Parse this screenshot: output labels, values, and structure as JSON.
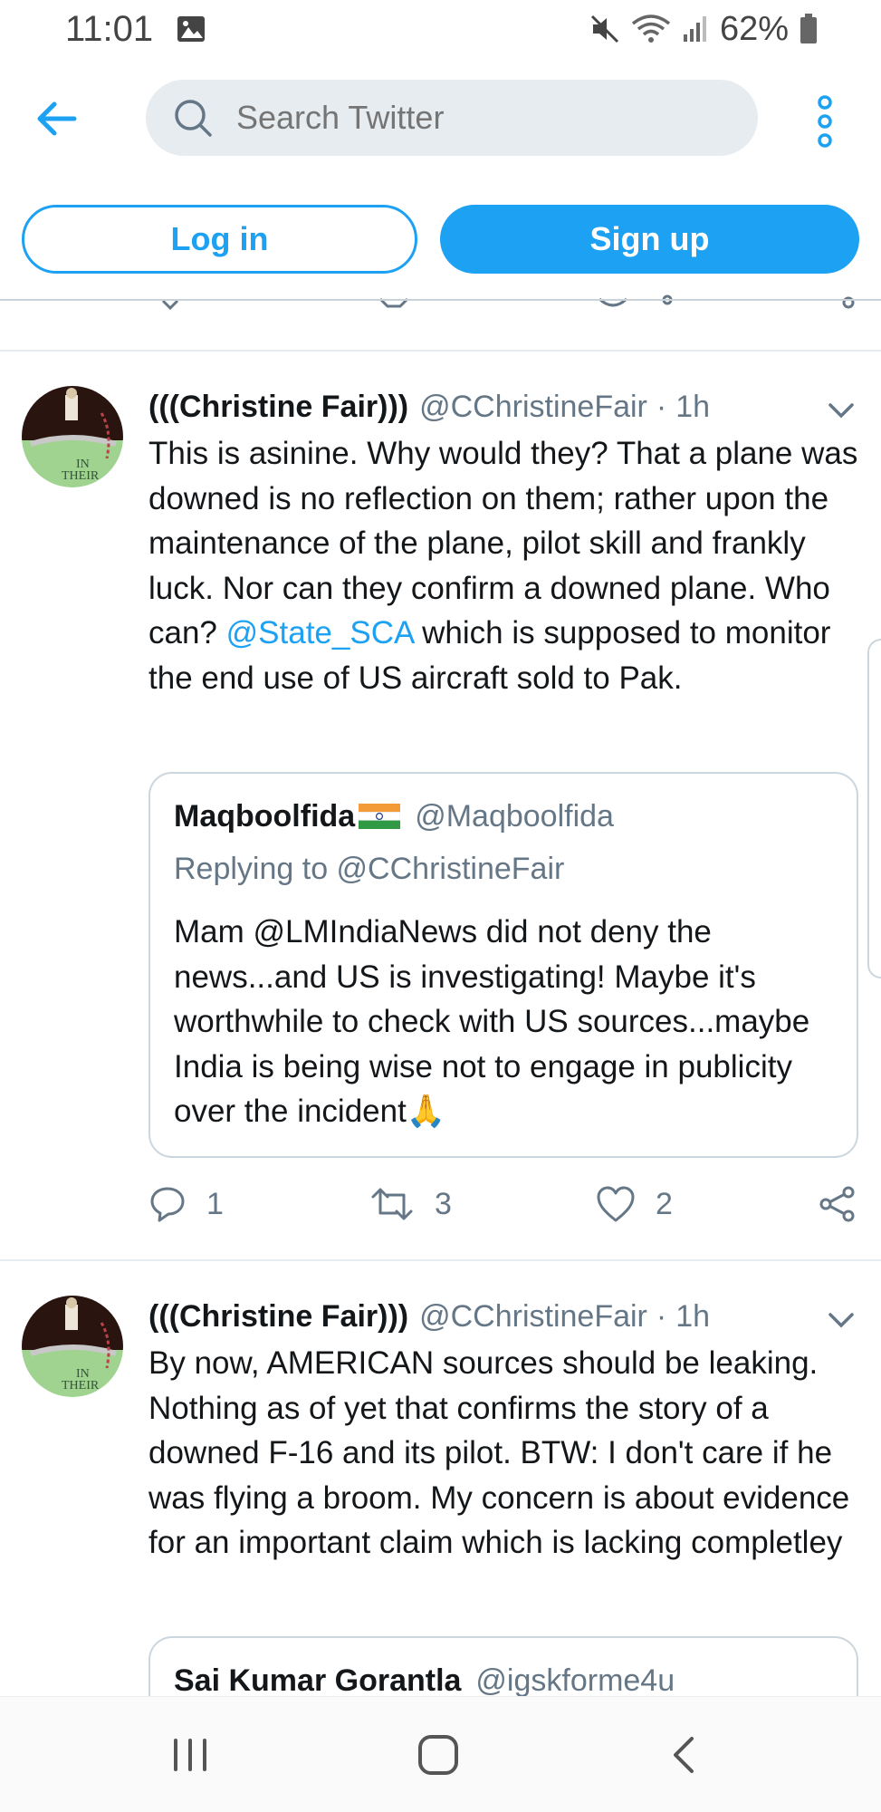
{
  "status_bar": {
    "time": "11:01",
    "battery": "62%"
  },
  "search": {
    "placeholder": "Search Twitter"
  },
  "auth": {
    "login_label": "Log in",
    "signup_label": "Sign up"
  },
  "tweets": [
    {
      "name": "(((Christine Fair)))",
      "handle": "@CChristineFair",
      "dot": "·",
      "time": "1h",
      "text_before": "This is asinine. Why would they? That a plane was downed is no reflection on them; rather upon the maintenance of the plane, pilot skill and frankly luck. Nor can they confirm a downed plane. Who can? ",
      "text_mention": "@State_SCA",
      "text_after": " which is supposed to monitor the end use of US aircraft sold to Pak.",
      "quote": {
        "name": "Maqboolfida",
        "handle": "@Maqboolfida",
        "replying_to": "Replying to @CChristineFair",
        "text": "Mam @LMIndiaNews did not deny the news...and US is investigating! Maybe it's worthwhile to check with US sources...maybe India is being wise not to engage in publicity over the incident🙏"
      },
      "replies": "1",
      "retweets": "3",
      "likes": "2"
    },
    {
      "name": "(((Christine Fair)))",
      "handle": "@CChristineFair",
      "dot": "·",
      "time": "1h",
      "text": "By now, AMERICAN sources should be leaking. Nothing as of yet that confirms the story of a downed F-16 and its pilot. BTW: I don't care if he was flying a broom.  My concern is about evidence for an important claim which is lacking completley",
      "quote": {
        "name": "Sai Kumar Gorantla",
        "handle": "@igskforme4u"
      }
    }
  ],
  "avatar_text": "IN THEIR OWN"
}
